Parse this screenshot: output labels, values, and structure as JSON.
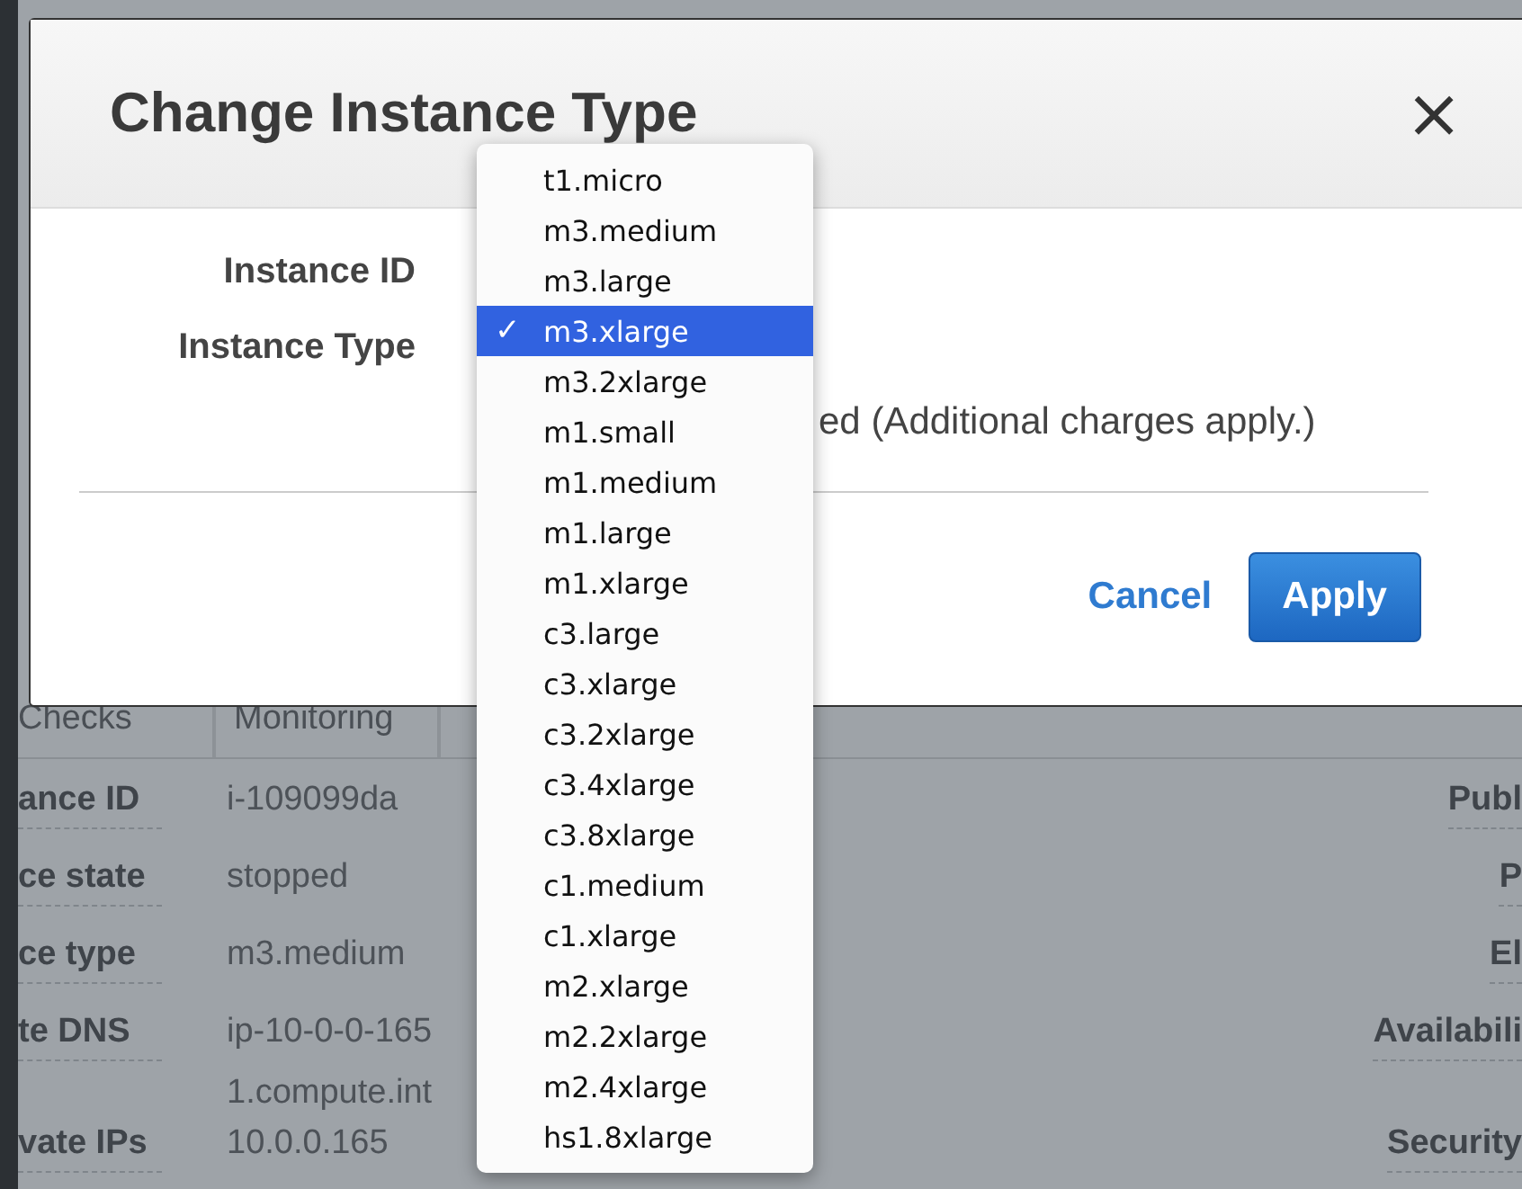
{
  "page": {
    "tabs": [
      {
        "label": "Checks"
      },
      {
        "label": "Monitoring"
      }
    ],
    "details": [
      {
        "label": "ance ID",
        "values": [
          "i-109099da"
        ],
        "right_label": "Publ"
      },
      {
        "label": "ce state",
        "values": [
          "stopped"
        ],
        "right_label": "P"
      },
      {
        "label": "ce type",
        "values": [
          "m3.medium"
        ],
        "right_label": "El"
      },
      {
        "label": "te DNS",
        "values": [
          "ip-10-0-0-165",
          "1.compute.int"
        ],
        "right_label": "Availabili"
      },
      {
        "label": "vate IPs",
        "values": [
          "10.0.0.165"
        ],
        "right_label": "Security"
      }
    ]
  },
  "dialog": {
    "title": "Change Instance Type",
    "close": "×",
    "fields": [
      {
        "label": "Instance ID"
      },
      {
        "label": "Instance Type"
      }
    ],
    "note": "ed (Additional charges apply.)",
    "buttons": [
      {
        "label": "Cancel",
        "kind": "link"
      },
      {
        "label": "Apply",
        "kind": "primary"
      }
    ]
  },
  "dropdown": {
    "check": "✓",
    "options": [
      {
        "label": "t1.micro",
        "selected": false
      },
      {
        "label": "m3.medium",
        "selected": false
      },
      {
        "label": "m3.large",
        "selected": false
      },
      {
        "label": "m3.xlarge",
        "selected": true
      },
      {
        "label": "m3.2xlarge",
        "selected": false
      },
      {
        "label": "m1.small",
        "selected": false
      },
      {
        "label": "m1.medium",
        "selected": false
      },
      {
        "label": "m1.large",
        "selected": false
      },
      {
        "label": "m1.xlarge",
        "selected": false
      },
      {
        "label": "c3.large",
        "selected": false
      },
      {
        "label": "c3.xlarge",
        "selected": false
      },
      {
        "label": "c3.2xlarge",
        "selected": false
      },
      {
        "label": "c3.4xlarge",
        "selected": false
      },
      {
        "label": "c3.8xlarge",
        "selected": false
      },
      {
        "label": "c1.medium",
        "selected": false
      },
      {
        "label": "c1.xlarge",
        "selected": false
      },
      {
        "label": "m2.xlarge",
        "selected": false
      },
      {
        "label": "m2.2xlarge",
        "selected": false
      },
      {
        "label": "m2.4xlarge",
        "selected": false
      },
      {
        "label": "hs1.8xlarge",
        "selected": false
      }
    ]
  }
}
